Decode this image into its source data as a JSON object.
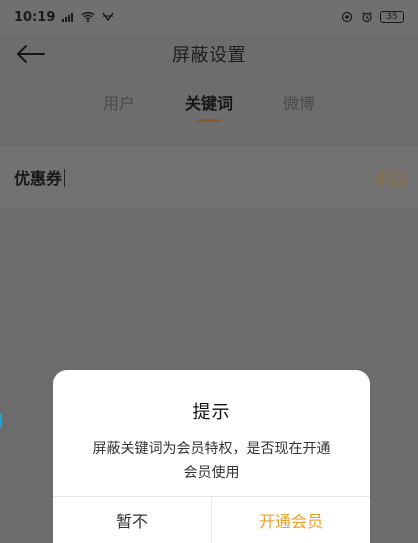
{
  "status_bar": {
    "time": "10:19",
    "battery": "35",
    "icons": {
      "signal": "signal-icon",
      "wifi": "wifi-icon",
      "data": "data-icon",
      "eye": "eye-icon",
      "alarm": "alarm-icon"
    }
  },
  "header": {
    "title": "屏蔽设置",
    "back_icon": "back-arrow-icon"
  },
  "tabs": [
    {
      "label": "用户",
      "active": false
    },
    {
      "label": "关键词",
      "active": true
    },
    {
      "label": "微博",
      "active": false
    }
  ],
  "keyword_row": {
    "value": "优惠券",
    "action_label": "添加"
  },
  "modal": {
    "title": "提示",
    "message_line1": "屏蔽关键词为会员特权，是否现在开通",
    "message_line2": "会员使用",
    "cancel_label": "暂不",
    "confirm_label": "开通会员"
  },
  "colors": {
    "accent": "#ef9f27",
    "tab_indicator": "#8b5a2b",
    "overlay_background": "#6c6c6c"
  }
}
